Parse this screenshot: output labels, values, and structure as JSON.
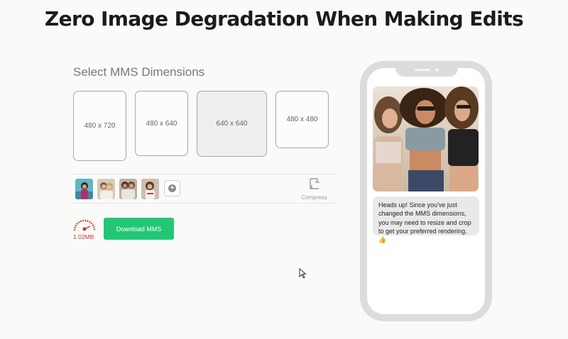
{
  "headline": "Zero Image Degradation When Making Edits",
  "dimensions": {
    "title": "Select MMS Dimensions",
    "options": [
      {
        "label": "480 x 720",
        "selected": false
      },
      {
        "label": "480 x 640",
        "selected": false
      },
      {
        "label": "640 x 640",
        "selected": true
      },
      {
        "label": "480 x 480",
        "selected": false
      }
    ]
  },
  "toolbar": {
    "compress_label": "Compress",
    "add_icon": "plus-icon"
  },
  "file": {
    "size": "1.02MB"
  },
  "actions": {
    "download_label": "Download MMS"
  },
  "phone": {
    "message": "Heads up! Since you've just changed the MMS dimensions, you may need to resize and crop to get your preferred rendering.",
    "emoji": "👍"
  },
  "colors": {
    "accent_green": "#22c773",
    "size_red": "#c23b2f"
  }
}
